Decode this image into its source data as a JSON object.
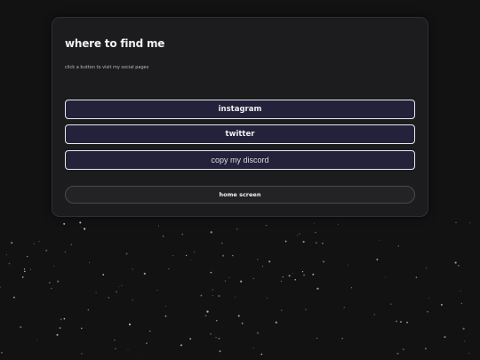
{
  "card": {
    "title": "where to find me",
    "subtitle": "click a button to visit my social pages"
  },
  "buttons": {
    "instagram": "instagram",
    "twitter": "twitter",
    "discord": "copy my discord",
    "home": "home screen"
  },
  "colors": {
    "background": "#121212",
    "card": "#1c1c1f",
    "button_fill": "#24223a",
    "button_border": "#e8e8ee",
    "star": "#cfcfcf"
  }
}
